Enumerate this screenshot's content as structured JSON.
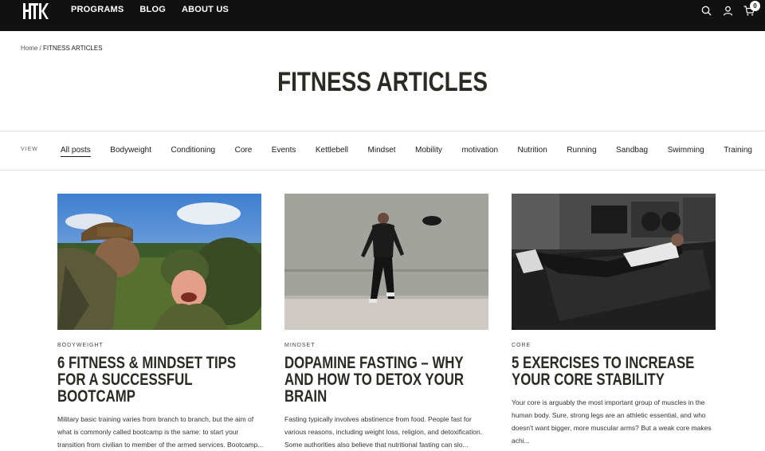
{
  "header": {
    "logo": "HTK",
    "nav": [
      "PROGRAMS",
      "BLOG",
      "ABOUT US"
    ],
    "cart_count": "0"
  },
  "breadcrumb": {
    "home": "Home",
    "separator": "/",
    "current": "FITNESS ARTICLES"
  },
  "page": {
    "title": "FITNESS ARTICLES"
  },
  "filter": {
    "label": "VIEW",
    "items": [
      "All posts",
      "Bodyweight",
      "Conditioning",
      "Core",
      "Events",
      "Kettlebell",
      "Mindset",
      "Mobility",
      "motivation",
      "Nutrition",
      "Running",
      "Sandbag",
      "Swimming",
      "Training"
    ]
  },
  "articles": [
    {
      "category": "BODYWEIGHT",
      "title": "6 FITNESS & MINDSET TIPS FOR A SUCCESSFUL BOOTCAMP",
      "excerpt": "Military basic training varies from branch to branch, but the aim of what is commonly called bootcamp is the same: to start your transition from civilian to member of the armed services. Bootcamp..."
    },
    {
      "category": "MINDSET",
      "title": "DOPAMINE FASTING – WHY AND HOW TO DETOX YOUR BRAIN",
      "excerpt": "Fasting typically involves abstinence from food. People fast for various reasons, including weight loss, religion, and detoxification. Some authorities also believe that nutritional fasting can slo..."
    },
    {
      "category": "CORE",
      "title": "5 EXERCISES TO INCREASE YOUR CORE STABILITY",
      "excerpt": "Your core is arguably the most important group of muscles in the human body. Sure, strong legs are an athletic essential, and who doesn't want bigger, more muscular arms? But a weak core makes achi..."
    }
  ]
}
